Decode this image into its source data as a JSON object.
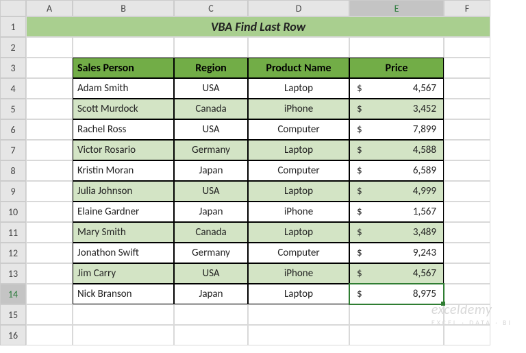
{
  "colHeaders": [
    "A",
    "B",
    "C",
    "D",
    "E",
    "F"
  ],
  "rowHeaders": [
    "1",
    "2",
    "3",
    "4",
    "5",
    "6",
    "7",
    "8",
    "9",
    "10",
    "11",
    "12",
    "13",
    "14",
    "15",
    "16"
  ],
  "title": "VBA Find Last Row",
  "headers": {
    "salesPerson": "Sales Person",
    "region": "Region",
    "productName": "Product Name",
    "price": "Price"
  },
  "currency": "$",
  "rows": [
    {
      "salesPerson": "Adam Smith",
      "region": "USA",
      "productName": "Laptop",
      "price": "4,567",
      "alt": false
    },
    {
      "salesPerson": "Scott Murdock",
      "region": "Canada",
      "productName": "iPhone",
      "price": "3,452",
      "alt": true
    },
    {
      "salesPerson": "Rachel Ross",
      "region": "USA",
      "productName": "Computer",
      "price": "7,899",
      "alt": false
    },
    {
      "salesPerson": "Victor Rosario",
      "region": "Germany",
      "productName": "Laptop",
      "price": "4,588",
      "alt": true
    },
    {
      "salesPerson": "Kristin Moran",
      "region": "Japan",
      "productName": "Computer",
      "price": "6,589",
      "alt": false
    },
    {
      "salesPerson": "Julia Johnson",
      "region": "USA",
      "productName": "Laptop",
      "price": "4,999",
      "alt": true
    },
    {
      "salesPerson": "Elaine Gardner",
      "region": "Japan",
      "productName": "iPhone",
      "price": "1,567",
      "alt": false
    },
    {
      "salesPerson": "Mary Smith",
      "region": "Canada",
      "productName": "Laptop",
      "price": "3,489",
      "alt": true
    },
    {
      "salesPerson": "Jonathon Swift",
      "region": "Germany",
      "productName": "Computer",
      "price": "9,243",
      "alt": false
    },
    {
      "salesPerson": "Jim Carry",
      "region": "USA",
      "productName": "iPhone",
      "price": "4,567",
      "alt": true
    },
    {
      "salesPerson": "Nick Branson",
      "region": "Japan",
      "productName": "Laptop",
      "price": "8,975",
      "alt": false
    }
  ],
  "activeCell": {
    "row": 14,
    "col": "E"
  },
  "watermark": {
    "main": "exceldemy",
    "sub": "EXCEL · DATA · BI"
  },
  "chart_data": {
    "type": "table",
    "title": "VBA Find Last Row",
    "columns": [
      "Sales Person",
      "Region",
      "Product Name",
      "Price"
    ],
    "data": [
      [
        "Adam Smith",
        "USA",
        "Laptop",
        4567
      ],
      [
        "Scott Murdock",
        "Canada",
        "iPhone",
        3452
      ],
      [
        "Rachel Ross",
        "USA",
        "Computer",
        7899
      ],
      [
        "Victor Rosario",
        "Germany",
        "Laptop",
        4588
      ],
      [
        "Kristin Moran",
        "Japan",
        "Computer",
        6589
      ],
      [
        "Julia Johnson",
        "USA",
        "Laptop",
        4999
      ],
      [
        "Elaine Gardner",
        "Japan",
        "iPhone",
        1567
      ],
      [
        "Mary Smith",
        "Canada",
        "Laptop",
        3489
      ],
      [
        "Jonathon Swift",
        "Germany",
        "Computer",
        9243
      ],
      [
        "Jim Carry",
        "USA",
        "iPhone",
        4567
      ],
      [
        "Nick Branson",
        "Japan",
        "Laptop",
        8975
      ]
    ]
  }
}
